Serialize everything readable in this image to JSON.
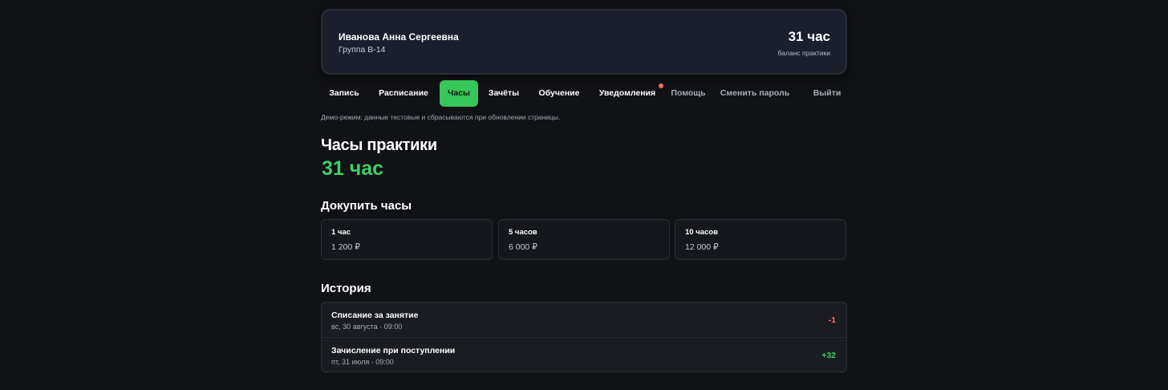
{
  "profile": {
    "name": "Иванова Анна Сергеевна",
    "group": "Группа В-14",
    "balance": "31 час",
    "balance_caption": "баланс практики"
  },
  "nav": {
    "items": [
      {
        "label": "Запись"
      },
      {
        "label": "Расписание"
      },
      {
        "label": "Часы",
        "active": true
      },
      {
        "label": "Зачёты"
      },
      {
        "label": "Обучение"
      },
      {
        "label": "Уведомления",
        "has_notification": true
      },
      {
        "label": "Помощь"
      },
      {
        "label": "Сменить пароль"
      },
      {
        "label": "Выйти"
      }
    ]
  },
  "demo_note": "Демо-режим: данные тестовые и сбрасываются при обновлении страницы.",
  "hours": {
    "title": "Часы практики",
    "value": "31 час"
  },
  "buy": {
    "title": "Докупить часы",
    "packages": [
      {
        "title": "1 час",
        "price": "1 200 ₽"
      },
      {
        "title": "5 часов",
        "price": "6 000 ₽"
      },
      {
        "title": "10 часов",
        "price": "12 000 ₽"
      }
    ]
  },
  "history": {
    "title": "История",
    "rows": [
      {
        "title": "Списание за занятие",
        "date": "вс, 30 августа · 09:00",
        "amount": "-1",
        "type": "debit"
      },
      {
        "title": "Зачисление при поступлении",
        "date": "пт, 31 июля · 09:00",
        "amount": "+32",
        "type": "credit"
      }
    ]
  },
  "colors": {
    "accent": "#36c659",
    "debit": "#ff6a5a",
    "credit": "#3fcf63",
    "background": "#111216"
  }
}
